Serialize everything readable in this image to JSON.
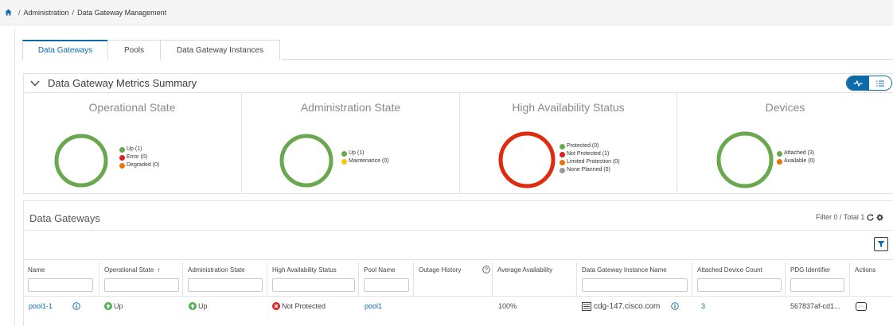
{
  "breadcrumb": {
    "items": [
      "Administration",
      "Data Gateway Management"
    ],
    "separator": "/"
  },
  "tabs": [
    {
      "label": "Data Gateways",
      "active": true
    },
    {
      "label": "Pools",
      "active": false
    },
    {
      "label": "Data Gateway Instances",
      "active": false
    }
  ],
  "summary": {
    "title": "Data Gateway Metrics Summary",
    "view_toggle": {
      "selected": "chart",
      "options": [
        "chart-view-icon",
        "list-view-icon"
      ]
    },
    "cards": [
      {
        "title": "Operational State",
        "ring_color": "#6aa84f",
        "legend": [
          {
            "label": "Up (1)",
            "color": "#6aa84f"
          },
          {
            "label": "Error (0)",
            "color": "#e02020"
          },
          {
            "label": "Degraded (0)",
            "color": "#e8740c"
          }
        ]
      },
      {
        "title": "Administration State",
        "ring_color": "#6aa84f",
        "legend": [
          {
            "label": "Up (1)",
            "color": "#6aa84f"
          },
          {
            "label": "Maintenance (0)",
            "color": "#f5c518"
          }
        ]
      },
      {
        "title": "High Availability Status",
        "ring_color": "#e02a0e",
        "legend": [
          {
            "label": "Protected (0)",
            "color": "#6aa84f"
          },
          {
            "label": "Not Protected (1)",
            "color": "#e02020"
          },
          {
            "label": "Limited Protection (0)",
            "color": "#e8740c"
          },
          {
            "label": "None Planned (0)",
            "color": "#9a9a9a"
          }
        ]
      },
      {
        "title": "Devices",
        "ring_color": "#6aa84f",
        "legend": [
          {
            "label": "Attached (3)",
            "color": "#6aa84f"
          },
          {
            "label": "Available (0)",
            "color": "#e8740c"
          }
        ]
      }
    ]
  },
  "grid": {
    "title": "Data Gateways",
    "filter_info": "Filter 0 / Total 1",
    "columns": [
      "Name",
      "Operational State",
      "Administration State",
      "High Availability Status",
      "Pool Name",
      "Outage History",
      "Average Availability",
      "Data Gateway Instance Name",
      "Attached Device Count",
      "PDG Identifier",
      "Actions"
    ],
    "sort_indicator": "↑",
    "rows": [
      {
        "name": "pool1-1",
        "operational_state": "Up",
        "administration_state": "Up",
        "ha_status": "Not Protected",
        "pool_name": "pool1",
        "outage_history": "",
        "average_availability": "100%",
        "instance_name": "cdg-147.cisco.com",
        "attached_device_count": "3",
        "pdg_identifier": "567837af-cd1...",
        "actions": "···"
      }
    ]
  },
  "colors": {
    "accent": "#0d6aa8",
    "up_green": "#4caf50",
    "error_red": "#e02020"
  }
}
